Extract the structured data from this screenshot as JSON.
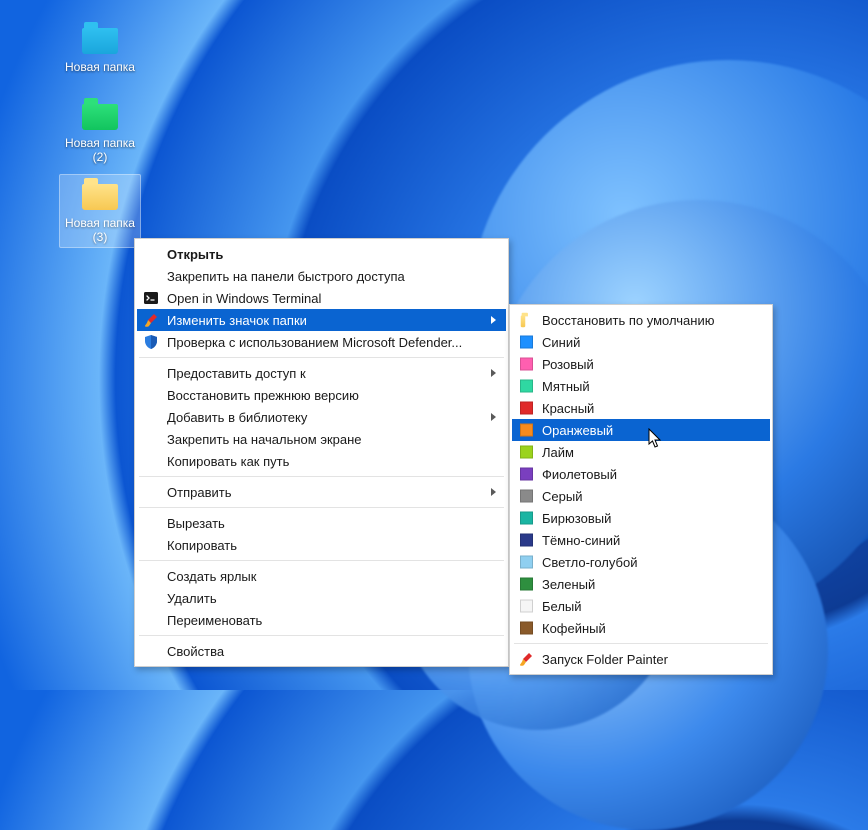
{
  "desktop": {
    "icons": [
      {
        "label": "Новая папка",
        "color": "blue"
      },
      {
        "label": "Новая папка (2)",
        "color": "green"
      },
      {
        "label": "Новая папка (3)",
        "color": "yellow",
        "selected": true
      }
    ]
  },
  "context_menu": {
    "items": [
      {
        "label": "Открыть",
        "bold": true
      },
      {
        "label": "Закрепить на панели быстрого доступа"
      },
      {
        "label": "Open in Windows Terminal",
        "icon": "terminal"
      },
      {
        "label": "Изменить значок папки",
        "icon": "painter",
        "submenu": true,
        "highlighted": true
      },
      {
        "label": "Проверка с использованием Microsoft Defender...",
        "icon": "shield"
      },
      {
        "sep": true
      },
      {
        "label": "Предоставить доступ к",
        "submenu": true
      },
      {
        "label": "Восстановить прежнюю версию"
      },
      {
        "label": "Добавить в библиотеку",
        "submenu": true
      },
      {
        "label": "Закрепить на начальном экране"
      },
      {
        "label": "Копировать как путь"
      },
      {
        "sep": true
      },
      {
        "label": "Отправить",
        "submenu": true
      },
      {
        "sep": true
      },
      {
        "label": "Вырезать"
      },
      {
        "label": "Копировать"
      },
      {
        "sep": true
      },
      {
        "label": "Создать ярлык"
      },
      {
        "label": "Удалить"
      },
      {
        "label": "Переименовать"
      },
      {
        "sep": true
      },
      {
        "label": "Свойства"
      }
    ]
  },
  "submenu": {
    "restore_label": "Восстановить по умолчанию",
    "colors": [
      {
        "label": "Синий",
        "hex": "#1e90ff"
      },
      {
        "label": "Розовый",
        "hex": "#ff5fb0"
      },
      {
        "label": "Мятный",
        "hex": "#2fd8a2"
      },
      {
        "label": "Красный",
        "hex": "#e02a2a"
      },
      {
        "label": "Оранжевый",
        "hex": "#f58a1f",
        "highlighted": true
      },
      {
        "label": "Лайм",
        "hex": "#9bd31c"
      },
      {
        "label": "Фиолетовый",
        "hex": "#7a3fbf"
      },
      {
        "label": "Серый",
        "hex": "#8a8a8a"
      },
      {
        "label": "Бирюзовый",
        "hex": "#1ab5a3"
      },
      {
        "label": "Тёмно-синий",
        "hex": "#2a3a8a"
      },
      {
        "label": "Светло-голубой",
        "hex": "#8fcff0"
      },
      {
        "label": "Зеленый",
        "hex": "#2e8f3f"
      },
      {
        "label": "Белый",
        "hex": "#f5f5f5"
      },
      {
        "label": "Кофейный",
        "hex": "#8a5a2a"
      }
    ],
    "launch_label": "Запуск Folder Painter"
  }
}
